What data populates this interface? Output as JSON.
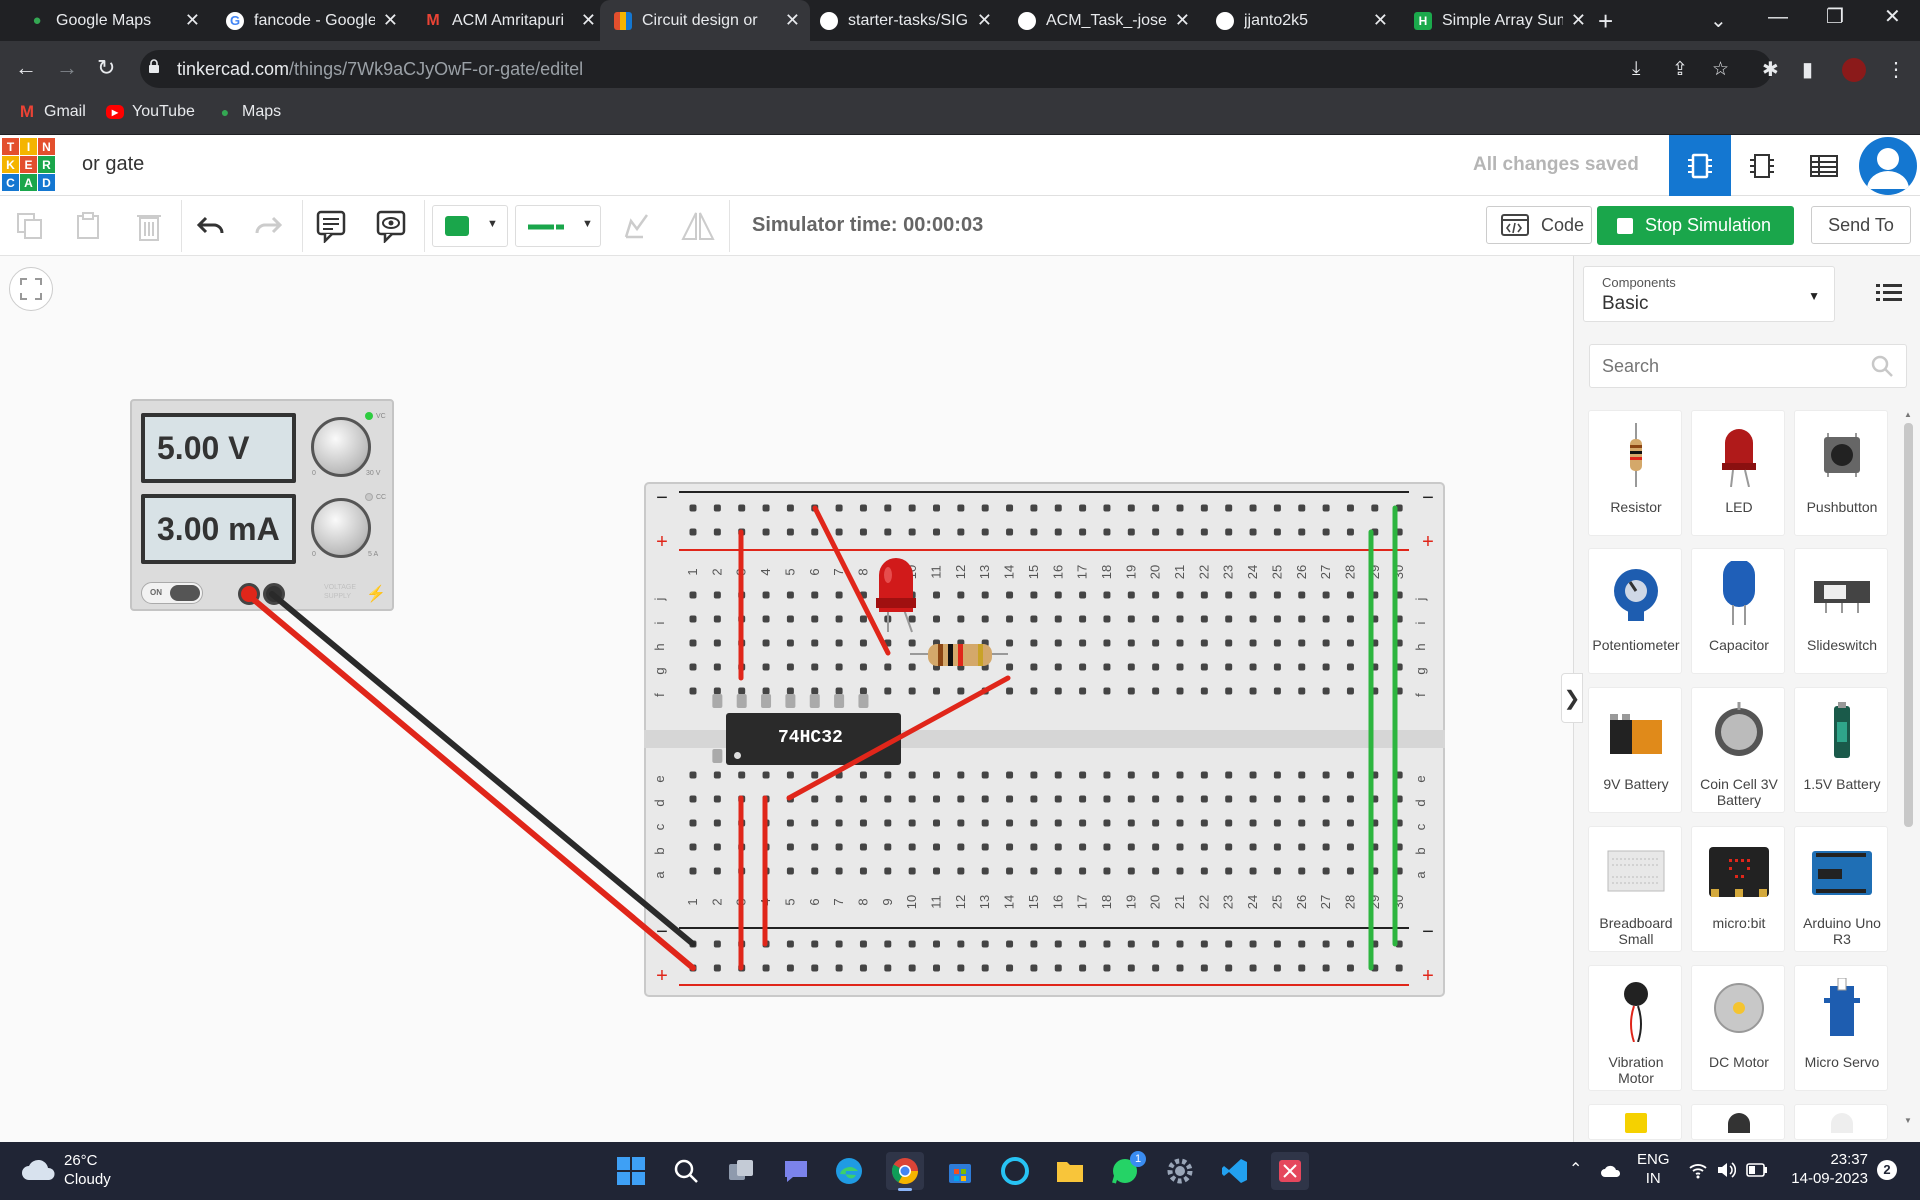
{
  "browser": {
    "tabs": [
      {
        "label": "Google Maps",
        "icon": "google-maps-icon",
        "color": "#34a853"
      },
      {
        "label": "fancode - Google",
        "icon": "google-icon",
        "color": "#4285f4"
      },
      {
        "label": "ACM Amritapuri",
        "icon": "gmail-icon",
        "color": "#ea4335"
      },
      {
        "label": "Circuit design or",
        "icon": "tinkercad-icon",
        "color": "#1477d1"
      },
      {
        "label": "starter-tasks/SIG",
        "icon": "github-icon",
        "color": "#ffffff"
      },
      {
        "label": "ACM_Task_-josew",
        "icon": "github-icon",
        "color": "#ffffff"
      },
      {
        "label": "jjanto2k5",
        "icon": "github-icon",
        "color": "#ffffff"
      },
      {
        "label": "Simple Array Sum",
        "icon": "hackerrank-icon",
        "color": "#1ba94c"
      }
    ],
    "active_tab_index": 3,
    "url_host": "tinkercad.com",
    "url_path": "/things/7Wk9aCJyOwF-or-gate/editel",
    "bookmarks": [
      {
        "label": "Gmail",
        "icon": "gmail-icon"
      },
      {
        "label": "YouTube",
        "icon": "youtube-icon"
      },
      {
        "label": "Maps",
        "icon": "maps-icon"
      }
    ]
  },
  "app": {
    "logo_letters": [
      "T",
      "I",
      "N",
      "K",
      "E",
      "R",
      "C",
      "A",
      "D"
    ],
    "doc_title": "or gate",
    "save_status": "All changes saved"
  },
  "toolbar": {
    "simulator_time": "Simulator time: 00:00:03",
    "code_label": "Code",
    "stop_label": "Stop Simulation",
    "send_to_label": "Send To",
    "wire_color": "#1aa64b"
  },
  "canvas": {
    "power_supply": {
      "voltage": "5.00 V",
      "current": "3.00 mA",
      "switch_label": "ON",
      "v_min": "0",
      "v_max": "30 V",
      "i_min": "0",
      "i_max": "5 A",
      "vc_label": "VC",
      "cc_label": "CC",
      "brand": "VOLTAGE SUPPLY"
    },
    "chip_label": "74HC32",
    "breadboard": {
      "rows_top": [
        "j",
        "i",
        "h",
        "g",
        "f"
      ],
      "rows_bottom": [
        "e",
        "d",
        "c",
        "b",
        "a"
      ],
      "columns": [
        "1",
        "2",
        "3",
        "4",
        "5",
        "6",
        "7",
        "8",
        "9",
        "10",
        "11",
        "12",
        "13",
        "14",
        "15",
        "16",
        "17",
        "18",
        "19",
        "20",
        "21",
        "22",
        "23",
        "24",
        "25",
        "26",
        "27",
        "28",
        "29",
        "30"
      ],
      "minus": "−",
      "plus": "+"
    }
  },
  "panel": {
    "components_label": "Components",
    "components_value": "Basic",
    "search_placeholder": "Search",
    "items": [
      {
        "label": "Resistor",
        "icon": "resistor-icon"
      },
      {
        "label": "LED",
        "icon": "led-icon"
      },
      {
        "label": "Pushbutton",
        "icon": "pushbutton-icon"
      },
      {
        "label": "Potentiometer",
        "icon": "potentiometer-icon"
      },
      {
        "label": "Capacitor",
        "icon": "capacitor-icon"
      },
      {
        "label": "Slideswitch",
        "icon": "slideswitch-icon"
      },
      {
        "label": "9V Battery",
        "icon": "battery-9v-icon"
      },
      {
        "label": "Coin Cell 3V Battery",
        "icon": "coin-cell-icon"
      },
      {
        "label": "1.5V Battery",
        "icon": "battery-aa-icon"
      },
      {
        "label": "Breadboard Small",
        "icon": "breadboard-icon"
      },
      {
        "label": "micro:bit",
        "icon": "microbit-icon"
      },
      {
        "label": "Arduino Uno R3",
        "icon": "arduino-icon"
      },
      {
        "label": "Vibration Motor",
        "icon": "vibration-motor-icon"
      },
      {
        "label": "DC Motor",
        "icon": "dc-motor-icon"
      },
      {
        "label": "Micro Servo",
        "icon": "micro-servo-icon"
      }
    ]
  },
  "taskbar": {
    "temperature": "26°C",
    "weather": "Cloudy",
    "language_1": "ENG",
    "language_2": "IN",
    "time": "23:37",
    "date": "14-09-2023",
    "whatsapp_badge": "1",
    "notification_count": "2"
  }
}
